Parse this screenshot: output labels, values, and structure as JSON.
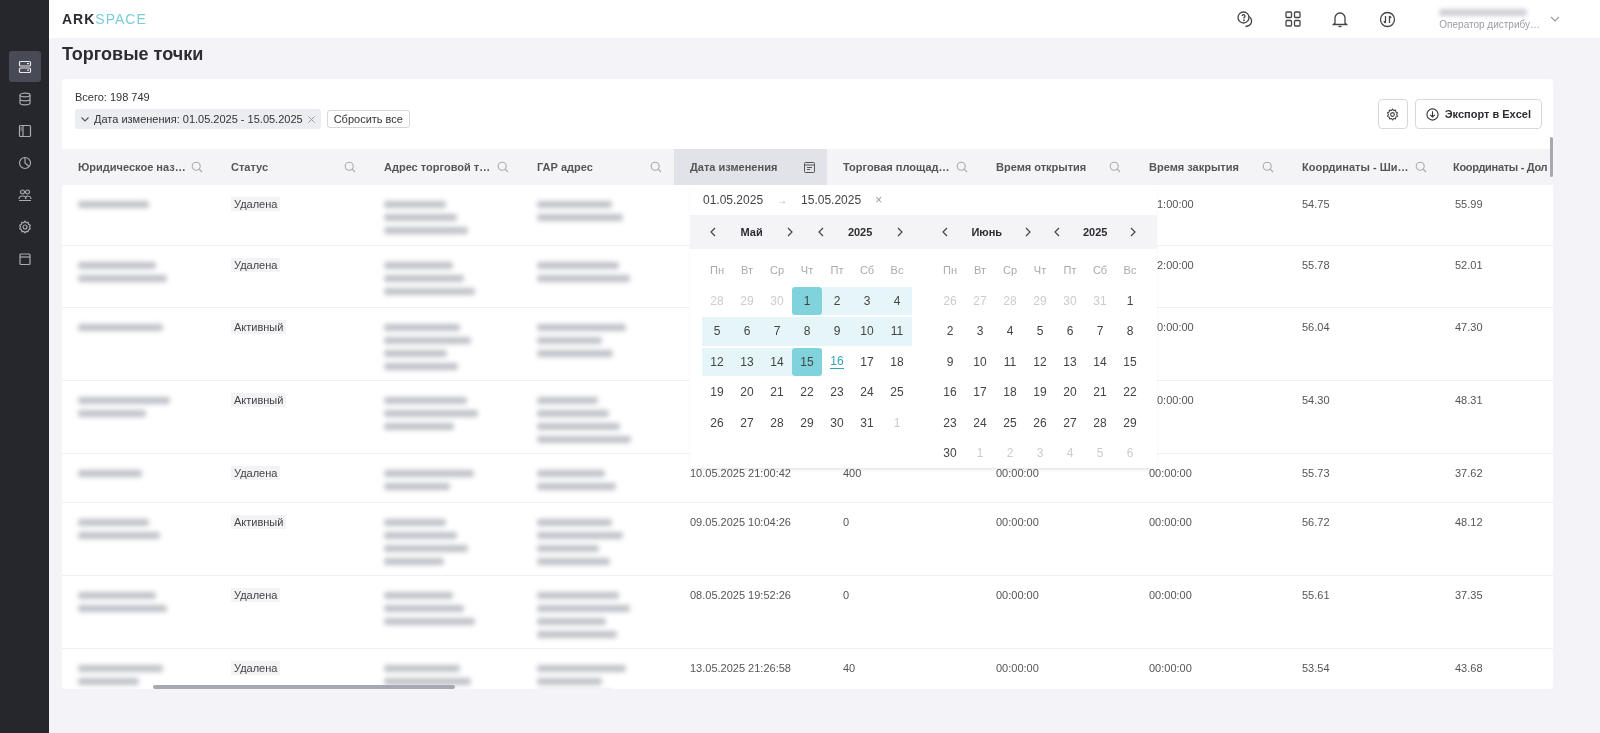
{
  "logo": {
    "strong": "ARK",
    "light": "SPACE"
  },
  "sidebar": {
    "items": [
      {
        "selected": true
      },
      {
        "selected": false
      },
      {
        "selected": false
      },
      {
        "selected": false
      },
      {
        "selected": false
      },
      {
        "selected": false
      },
      {
        "selected": false
      }
    ]
  },
  "user": {
    "role": "Оператор дистрибу…"
  },
  "page_title": "Торговые точки",
  "total": "Всего: 198 749",
  "filter_chip": "Дата изменения: 01.05.2025 - 15.05.2025",
  "reset_button": "Сбросить все",
  "export_button": "Экспорт в Excel",
  "columns": [
    {
      "label": "Юридическое наз…",
      "kind": "search",
      "active": false
    },
    {
      "label": "Статус",
      "kind": "search",
      "active": false
    },
    {
      "label": "Адрес торговой т…",
      "kind": "search",
      "active": false
    },
    {
      "label": "ГАР адрес",
      "kind": "search",
      "active": false
    },
    {
      "label": "Дата изменения",
      "kind": "calendar",
      "active": true
    },
    {
      "label": "Торговая площад…",
      "kind": "search",
      "active": false
    },
    {
      "label": "Время открытия",
      "kind": "search",
      "active": false
    },
    {
      "label": "Время закрытия",
      "kind": "search",
      "active": false
    },
    {
      "label": "Координаты - Ши…",
      "kind": "search",
      "active": false
    },
    {
      "label": "Координаты - Дол",
      "kind": "plain",
      "active": false
    }
  ],
  "rows": [
    {
      "cells": [
        {
          "kind": "blur"
        },
        {
          "kind": "tag",
          "text": "Удалена"
        },
        {
          "kind": "blur"
        },
        {
          "kind": "blur"
        },
        null,
        null,
        null,
        {
          "kind": "partial",
          "text": "1:00:00"
        },
        {
          "kind": "text",
          "text": "54.75"
        },
        {
          "kind": "text",
          "text": "55.99"
        }
      ]
    },
    {
      "cells": [
        {
          "kind": "blur"
        },
        {
          "kind": "tag",
          "text": "Удалена"
        },
        {
          "kind": "blur"
        },
        {
          "kind": "blur"
        },
        null,
        null,
        null,
        {
          "kind": "partial",
          "text": "2:00:00"
        },
        {
          "kind": "text",
          "text": "55.78"
        },
        {
          "kind": "text",
          "text": "52.01"
        }
      ]
    },
    {
      "cells": [
        {
          "kind": "blur"
        },
        {
          "kind": "tag",
          "text": "Активный"
        },
        {
          "kind": "blur"
        },
        {
          "kind": "blur"
        },
        null,
        null,
        null,
        {
          "kind": "partial",
          "text": "0:00:00"
        },
        {
          "kind": "text",
          "text": "56.04"
        },
        {
          "kind": "text",
          "text": "47.30"
        }
      ]
    },
    {
      "cells": [
        {
          "kind": "blur"
        },
        {
          "kind": "tag",
          "text": "Активный"
        },
        {
          "kind": "blur"
        },
        {
          "kind": "blur"
        },
        null,
        null,
        null,
        {
          "kind": "partial",
          "text": "0:00:00"
        },
        {
          "kind": "text",
          "text": "54.30"
        },
        {
          "kind": "text",
          "text": "48.31"
        }
      ]
    },
    {
      "cells": [
        {
          "kind": "blur"
        },
        {
          "kind": "tag",
          "text": "Удалена"
        },
        {
          "kind": "blur"
        },
        {
          "kind": "blur"
        },
        {
          "kind": "text",
          "text": "10.05.2025 21:00:42"
        },
        {
          "kind": "text",
          "text": "400"
        },
        {
          "kind": "text",
          "text": "00:00:00"
        },
        {
          "kind": "text",
          "text": "00:00:00"
        },
        {
          "kind": "text",
          "text": "55.73"
        },
        {
          "kind": "text",
          "text": "37.62"
        }
      ]
    },
    {
      "cells": [
        {
          "kind": "blur"
        },
        {
          "kind": "tag",
          "text": "Активный"
        },
        {
          "kind": "blur"
        },
        {
          "kind": "blur"
        },
        {
          "kind": "text",
          "text": "09.05.2025 10:04:26"
        },
        {
          "kind": "text",
          "text": "0"
        },
        {
          "kind": "text",
          "text": "00:00:00"
        },
        {
          "kind": "text",
          "text": "00:00:00"
        },
        {
          "kind": "text",
          "text": "56.72"
        },
        {
          "kind": "text",
          "text": "48.12"
        }
      ]
    },
    {
      "cells": [
        {
          "kind": "blur"
        },
        {
          "kind": "tag",
          "text": "Удалена"
        },
        {
          "kind": "blur"
        },
        {
          "kind": "blur"
        },
        {
          "kind": "text",
          "text": "08.05.2025 19:52:26"
        },
        {
          "kind": "text",
          "text": "0"
        },
        {
          "kind": "text",
          "text": "00:00:00"
        },
        {
          "kind": "text",
          "text": "00:00:00"
        },
        {
          "kind": "text",
          "text": "55.61"
        },
        {
          "kind": "text",
          "text": "37.35"
        }
      ]
    },
    {
      "cells": [
        {
          "kind": "blur"
        },
        {
          "kind": "tag",
          "text": "Удалена"
        },
        {
          "kind": "blur"
        },
        {
          "kind": "blur"
        },
        {
          "kind": "text",
          "text": "13.05.2025 21:26:58"
        },
        {
          "kind": "text",
          "text": "40"
        },
        {
          "kind": "text",
          "text": "00:00:00"
        },
        {
          "kind": "text",
          "text": "00:00:00"
        },
        {
          "kind": "text",
          "text": "53.54"
        },
        {
          "kind": "text",
          "text": "43.68"
        }
      ]
    }
  ],
  "date_picker": {
    "start": "01.05.2025",
    "arrow": "→",
    "end": "15.05.2025",
    "clear": "×",
    "months": [
      {
        "month": "Май",
        "year": "2025",
        "weekdays": [
          "Пн",
          "Вт",
          "Ср",
          "Чт",
          "Пт",
          "Сб",
          "Вс"
        ],
        "days": [
          {
            "d": "28",
            "kind": "outside",
            "selected": false
          },
          {
            "d": "29",
            "kind": "outside",
            "selected": false
          },
          {
            "d": "30",
            "kind": "outside",
            "selected": false
          },
          {
            "d": "1",
            "kind": "range",
            "selected": true
          },
          {
            "d": "2",
            "kind": "range",
            "selected": false
          },
          {
            "d": "3",
            "kind": "range",
            "selected": false
          },
          {
            "d": "4",
            "kind": "range",
            "selected": false
          },
          {
            "d": "5",
            "kind": "range",
            "selected": false
          },
          {
            "d": "6",
            "kind": "range",
            "selected": false
          },
          {
            "d": "7",
            "kind": "range",
            "selected": false
          },
          {
            "d": "8",
            "kind": "range",
            "selected": false
          },
          {
            "d": "9",
            "kind": "range",
            "selected": false
          },
          {
            "d": "10",
            "kind": "range",
            "selected": false
          },
          {
            "d": "11",
            "kind": "range",
            "selected": false
          },
          {
            "d": "12",
            "kind": "range",
            "selected": false
          },
          {
            "d": "13",
            "kind": "range",
            "selected": false
          },
          {
            "d": "14",
            "kind": "range",
            "selected": false
          },
          {
            "d": "15",
            "kind": "range",
            "selected": true
          },
          {
            "d": "16",
            "kind": "today",
            "selected": false
          },
          {
            "d": "17",
            "kind": "plain",
            "selected": false
          },
          {
            "d": "18",
            "kind": "plain",
            "selected": false
          },
          {
            "d": "19",
            "kind": "plain",
            "selected": false
          },
          {
            "d": "20",
            "kind": "plain",
            "selected": false
          },
          {
            "d": "21",
            "kind": "plain",
            "selected": false
          },
          {
            "d": "22",
            "kind": "plain",
            "selected": false
          },
          {
            "d": "23",
            "kind": "plain",
            "selected": false
          },
          {
            "d": "24",
            "kind": "plain",
            "selected": false
          },
          {
            "d": "25",
            "kind": "plain",
            "selected": false
          },
          {
            "d": "26",
            "kind": "plain",
            "selected": false
          },
          {
            "d": "27",
            "kind": "plain",
            "selected": false
          },
          {
            "d": "28",
            "kind": "plain",
            "selected": false
          },
          {
            "d": "29",
            "kind": "plain",
            "selected": false
          },
          {
            "d": "30",
            "kind": "plain",
            "selected": false
          },
          {
            "d": "31",
            "kind": "plain",
            "selected": false
          },
          {
            "d": "1",
            "kind": "outside",
            "selected": false
          }
        ]
      },
      {
        "month": "Июнь",
        "year": "2025",
        "weekdays": [
          "Пн",
          "Вт",
          "Ср",
          "Чт",
          "Пт",
          "Сб",
          "Вс"
        ],
        "days": [
          {
            "d": "26",
            "kind": "outside",
            "selected": false
          },
          {
            "d": "27",
            "kind": "outside",
            "selected": false
          },
          {
            "d": "28",
            "kind": "outside",
            "selected": false
          },
          {
            "d": "29",
            "kind": "outside",
            "selected": false
          },
          {
            "d": "30",
            "kind": "outside",
            "selected": false
          },
          {
            "d": "31",
            "kind": "outside",
            "selected": false
          },
          {
            "d": "1",
            "kind": "plain",
            "selected": false
          },
          {
            "d": "2",
            "kind": "plain",
            "selected": false
          },
          {
            "d": "3",
            "kind": "plain",
            "selected": false
          },
          {
            "d": "4",
            "kind": "plain",
            "selected": false
          },
          {
            "d": "5",
            "kind": "plain",
            "selected": false
          },
          {
            "d": "6",
            "kind": "plain",
            "selected": false
          },
          {
            "d": "7",
            "kind": "plain",
            "selected": false
          },
          {
            "d": "8",
            "kind": "plain",
            "selected": false
          },
          {
            "d": "9",
            "kind": "plain",
            "selected": false
          },
          {
            "d": "10",
            "kind": "plain",
            "selected": false
          },
          {
            "d": "11",
            "kind": "plain",
            "selected": false
          },
          {
            "d": "12",
            "kind": "plain",
            "selected": false
          },
          {
            "d": "13",
            "kind": "plain",
            "selected": false
          },
          {
            "d": "14",
            "kind": "plain",
            "selected": false
          },
          {
            "d": "15",
            "kind": "plain",
            "selected": false
          },
          {
            "d": "16",
            "kind": "plain",
            "selected": false
          },
          {
            "d": "17",
            "kind": "plain",
            "selected": false
          },
          {
            "d": "18",
            "kind": "plain",
            "selected": false
          },
          {
            "d": "19",
            "kind": "plain",
            "selected": false
          },
          {
            "d": "20",
            "kind": "plain",
            "selected": false
          },
          {
            "d": "21",
            "kind": "plain",
            "selected": false
          },
          {
            "d": "22",
            "kind": "plain",
            "selected": false
          },
          {
            "d": "23",
            "kind": "plain",
            "selected": false
          },
          {
            "d": "24",
            "kind": "plain",
            "selected": false
          },
          {
            "d": "25",
            "kind": "plain",
            "selected": false
          },
          {
            "d": "26",
            "kind": "plain",
            "selected": false
          },
          {
            "d": "27",
            "kind": "plain",
            "selected": false
          },
          {
            "d": "28",
            "kind": "plain",
            "selected": false
          },
          {
            "d": "29",
            "kind": "plain",
            "selected": false
          },
          {
            "d": "30",
            "kind": "plain",
            "selected": false
          },
          {
            "d": "1",
            "kind": "outside",
            "selected": false
          },
          {
            "d": "2",
            "kind": "outside",
            "selected": false
          },
          {
            "d": "3",
            "kind": "outside",
            "selected": false
          },
          {
            "d": "4",
            "kind": "outside",
            "selected": false
          },
          {
            "d": "5",
            "kind": "outside",
            "selected": false
          },
          {
            "d": "6",
            "kind": "outside",
            "selected": false
          }
        ]
      }
    ]
  }
}
